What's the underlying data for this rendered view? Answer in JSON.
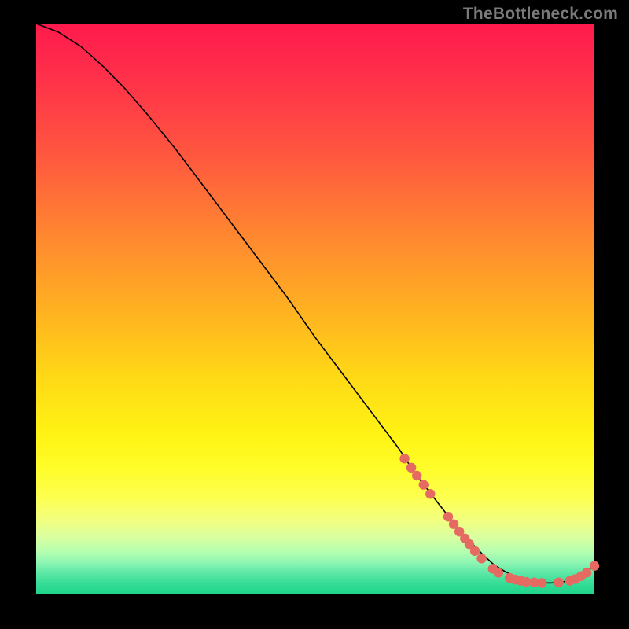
{
  "attribution": "TheBottleneck.com",
  "colors": {
    "page_bg": "#000000",
    "text": "#7a7a7a",
    "curve": "#000000",
    "dot": "#e46a62",
    "gradient_stops": [
      "#ff1a4d",
      "#ff2f4a",
      "#ff5a3e",
      "#ff8a2f",
      "#ffb71f",
      "#ffd916",
      "#fff314",
      "#fffd2a",
      "#fdff4f",
      "#f2ff80",
      "#d9ffa0",
      "#b5ffb0",
      "#8cf5b2",
      "#63e9a8",
      "#37dd97",
      "#1ed488"
    ]
  },
  "chart_data": {
    "type": "line",
    "title": "",
    "xlabel": "",
    "ylabel": "",
    "xlim": [
      0,
      100
    ],
    "ylim": [
      0,
      100
    ],
    "grid": false,
    "legend": false,
    "series": [
      {
        "name": "curve",
        "x": [
          0,
          4,
          8,
          12,
          16,
          20,
          25,
          30,
          35,
          40,
          45,
          50,
          55,
          60,
          65,
          68,
          72,
          76,
          78,
          80,
          82,
          84,
          86,
          88,
          90,
          92,
          94,
          96,
          98,
          100
        ],
        "y": [
          100,
          98.5,
          96,
          92.5,
          88.5,
          84,
          78,
          71.5,
          65,
          58.5,
          52,
          45,
          38.5,
          32,
          25.5,
          21,
          16,
          11,
          9,
          7,
          5.2,
          4,
          3,
          2.4,
          2.1,
          2,
          2.1,
          2.6,
          3.6,
          5
        ]
      }
    ],
    "scatter_points": {
      "name": "markers",
      "points": [
        {
          "x": 66.0,
          "y": 23.8
        },
        {
          "x": 67.2,
          "y": 22.2
        },
        {
          "x": 68.2,
          "y": 20.8
        },
        {
          "x": 69.4,
          "y": 19.2
        },
        {
          "x": 70.6,
          "y": 17.6
        },
        {
          "x": 73.8,
          "y": 13.6
        },
        {
          "x": 74.8,
          "y": 12.3
        },
        {
          "x": 75.8,
          "y": 11.0
        },
        {
          "x": 76.8,
          "y": 9.8
        },
        {
          "x": 77.6,
          "y": 8.8
        },
        {
          "x": 78.6,
          "y": 7.6
        },
        {
          "x": 79.8,
          "y": 6.3
        },
        {
          "x": 81.8,
          "y": 4.5
        },
        {
          "x": 82.8,
          "y": 3.8
        },
        {
          "x": 84.8,
          "y": 2.9
        },
        {
          "x": 85.8,
          "y": 2.6
        },
        {
          "x": 86.8,
          "y": 2.4
        },
        {
          "x": 87.8,
          "y": 2.2
        },
        {
          "x": 89.2,
          "y": 2.1
        },
        {
          "x": 90.6,
          "y": 2.0
        },
        {
          "x": 93.6,
          "y": 2.1
        },
        {
          "x": 95.6,
          "y": 2.4
        },
        {
          "x": 96.6,
          "y": 2.7
        },
        {
          "x": 97.6,
          "y": 3.2
        },
        {
          "x": 98.6,
          "y": 3.8
        },
        {
          "x": 100.0,
          "y": 5.0
        }
      ]
    }
  }
}
